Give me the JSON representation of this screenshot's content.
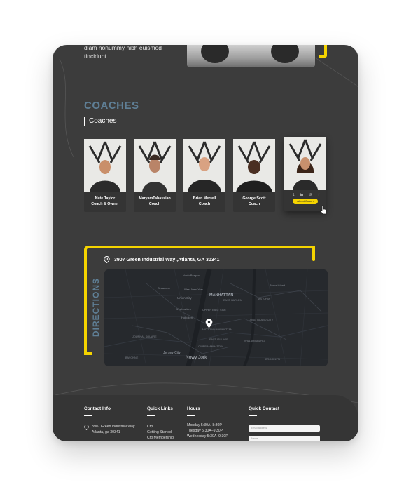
{
  "hero": {
    "text_line1": "diam nonummy nibh euismod",
    "text_line2": "tincidunt"
  },
  "coaches": {
    "title": "COACHES",
    "subtitle": "Coaches",
    "cards": [
      {
        "name": "Nate Taylor",
        "role": "Coach & Owner"
      },
      {
        "name": "MaryamTabassian",
        "role": "Coach"
      },
      {
        "name": "Brian Merrell",
        "role": "Coach"
      },
      {
        "name": "George Scott",
        "role": "Coach"
      },
      {
        "name": "",
        "role": "",
        "button": "About Coach",
        "social": [
          "twitter-icon",
          "linkedin-icon",
          "instagram-icon",
          "facebook-icon"
        ]
      }
    ]
  },
  "directions": {
    "label": "DIRECTIONS",
    "address": "3907 Green Industrial Way ,Atlanta, GA 30341",
    "map_labels": {
      "manhattan": "MANHATTAN",
      "jersey_city": "Jersey City",
      "new_york": "Nowy Jork",
      "union_city": "Union City",
      "north_bergen": "North Bergen",
      "west_new_york": "West New York",
      "weehawken": "Weehawken",
      "hoboken": "Hoboken",
      "secaucus": "Secaucus",
      "bronx": "Bronx Island",
      "east_harlem": "EAST HARLEM",
      "upper_east_side": "UPPER EAST SIDE",
      "midtown": "MIDTOWN MANHATTAN",
      "lower_manhattan": "LOWER MANHATTAN",
      "east_village": "EAST VILLAGE",
      "williamsburg": "WILLIAMSBURG",
      "astoria": "ASTORIA",
      "long_island_city": "LONG ISLAND CITY",
      "brooklyn": "BROOKLYN",
      "journal_square": "JOURNAL SQUARE",
      "bayonne": "BAYONNE"
    }
  },
  "footer": {
    "contact": {
      "title": "Contact Info",
      "address_line1": "3907 Green Industrial Way",
      "address_line2": "Atlanta, ga 30341"
    },
    "quick_links": {
      "title": "Quick Links",
      "items": [
        "Cfp",
        "Getting Started",
        "Cfp Membership"
      ]
    },
    "hours": {
      "title": "Hours",
      "items": [
        "Monday 5:30A–8:30P",
        "Tuesday 5:30A–9:30P",
        "Wednesday 5:30A–9:30P"
      ]
    },
    "quick_contact": {
      "title": "Quick Contact",
      "email_placeholder": "Email address",
      "name_placeholder": "Name"
    }
  },
  "colors": {
    "accent": "#f5d400",
    "heading_blue": "#5f7f96",
    "background": "#3c3c3c"
  }
}
